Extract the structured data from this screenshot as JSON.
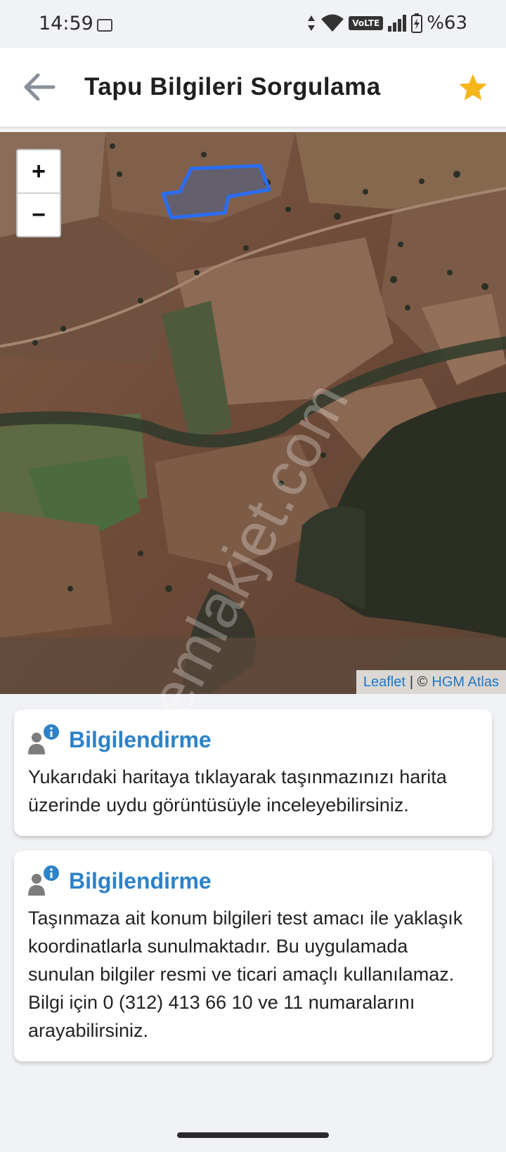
{
  "status_bar": {
    "time": "14:59",
    "battery": "%63",
    "network": "VoLTE",
    "icons": [
      "screen-record-icon",
      "data-arrows-icon",
      "wifi-icon",
      "signal-bars-icon",
      "battery-icon"
    ]
  },
  "app_bar": {
    "title": "Tapu Bilgileri Sorgulama",
    "back_icon": "arrow-left-icon",
    "favorite_icon": "star-icon",
    "favorite_color": "#f7b51c"
  },
  "map": {
    "zoom_in": "+",
    "zoom_out": "−",
    "attribution": {
      "link1": "Leaflet",
      "separator": "| ©",
      "link2": "HGM Atlas"
    },
    "parcel_outline_color": "#2b6df2",
    "watermark": "emlakjet.com"
  },
  "cards": [
    {
      "title": "Bilgilendirme",
      "icon": "user-info-icon",
      "text": "Yukarıdaki haritaya tıklayarak taşınmazınızı harita üzerinde uydu görüntüsüyle inceleyebilirsiniz."
    },
    {
      "title": "Bilgilendirme",
      "icon": "user-info-icon",
      "text": "Taşınmaza ait konum bilgileri test amacı ile yaklaşık koordinatlarla sunulmaktadır. Bu uygulamada sunulan bilgiler resmi ve ticari amaçlı kullanılamaz. Bilgi için 0 (312) 413 66 10 ve 11 numaralarını arayabilirsiniz."
    }
  ],
  "colors": {
    "accent": "#2d82c8",
    "background": "#f1f2f5"
  }
}
